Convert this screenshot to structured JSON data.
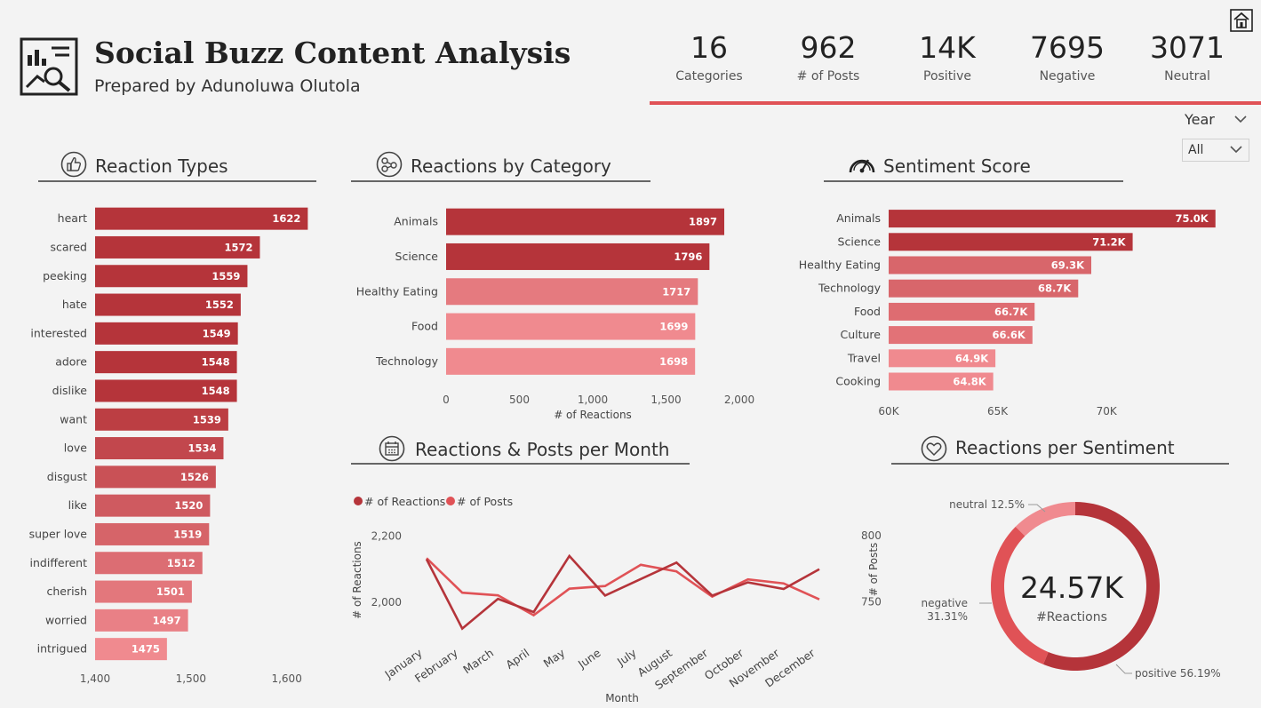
{
  "header": {
    "title": "Social Buzz Content Analysis",
    "subtitle": "Prepared by Adunoluwa Olutola"
  },
  "kpis": [
    {
      "value": "16",
      "label": "Categories"
    },
    {
      "value": "962",
      "label": "# of Posts"
    },
    {
      "value": "14K",
      "label": "Positive"
    },
    {
      "value": "7695",
      "label": "Negative"
    },
    {
      "value": "3071",
      "label": "Neutral"
    }
  ],
  "filter": {
    "label": "Year",
    "value": "All"
  },
  "sections": {
    "reaction_types": "Reaction Types",
    "reactions_by_category": "Reactions by Category",
    "sentiment_score": "Sentiment Score",
    "reactions_posts_month": "Reactions & Posts per Month",
    "reactions_per_sentiment": "Reactions per Sentiment"
  },
  "colors": {
    "accent": "#e05256",
    "dark_red": "#b5343a",
    "mid_red": "#d8666b",
    "light_red": "#f08a8f"
  },
  "chart_data": [
    {
      "id": "reaction_types",
      "type": "bar",
      "orientation": "horizontal",
      "categories": [
        "heart",
        "scared",
        "peeking",
        "hate",
        "interested",
        "adore",
        "dislike",
        "want",
        "love",
        "disgust",
        "like",
        "super love",
        "indifferent",
        "cherish",
        "worried",
        "intrigued"
      ],
      "values": [
        1622,
        1572,
        1559,
        1552,
        1549,
        1548,
        1548,
        1539,
        1534,
        1526,
        1520,
        1519,
        1512,
        1501,
        1497,
        1475
      ],
      "data_labels": [
        "1622",
        "1572",
        "1559",
        "1552",
        "1549",
        "1548",
        "1548",
        "1539",
        "1534",
        "1526",
        "1520",
        "1519",
        "1512",
        "1501",
        "1497",
        "1475"
      ],
      "xlim": [
        1400,
        1630
      ],
      "xticks": [
        1400,
        1500,
        1600
      ],
      "xtick_labels": [
        "1,400",
        "1,500",
        "1,600"
      ]
    },
    {
      "id": "reactions_by_category",
      "type": "bar",
      "orientation": "horizontal",
      "categories": [
        "Animals",
        "Science",
        "Healthy Eating",
        "Food",
        "Technology"
      ],
      "values": [
        1897,
        1796,
        1717,
        1699,
        1698
      ],
      "data_labels": [
        "1897",
        "1796",
        "1717",
        "1699",
        "1698"
      ],
      "xlim": [
        0,
        2000
      ],
      "xticks": [
        0,
        500,
        1000,
        1500,
        2000
      ],
      "xtick_labels": [
        "0",
        "500",
        "1,000",
        "1,500",
        "2,000"
      ],
      "xlabel": "# of Reactions"
    },
    {
      "id": "sentiment_score",
      "type": "bar",
      "orientation": "horizontal",
      "categories": [
        "Animals",
        "Science",
        "Healthy Eating",
        "Technology",
        "Food",
        "Culture",
        "Travel",
        "Cooking"
      ],
      "values": [
        75000,
        71200,
        69300,
        68700,
        66700,
        66600,
        64900,
        64800
      ],
      "data_labels": [
        "75.0K",
        "71.2K",
        "69.3K",
        "68.7K",
        "66.7K",
        "66.6K",
        "64.9K",
        "64.8K"
      ],
      "xlim": [
        60000,
        75500
      ],
      "xticks": [
        60000,
        65000,
        70000
      ],
      "xtick_labels": [
        "60K",
        "65K",
        "70K"
      ]
    },
    {
      "id": "reactions_posts_month",
      "type": "line",
      "categories": [
        "January",
        "February",
        "March",
        "April",
        "May",
        "June",
        "July",
        "August",
        "September",
        "October",
        "November",
        "December"
      ],
      "series": [
        {
          "name": "# of Reactions",
          "axis": "left",
          "values": [
            2130,
            1920,
            2010,
            1970,
            2140,
            2020,
            2070,
            2120,
            2020,
            2060,
            2040,
            2100
          ]
        },
        {
          "name": "# of Posts",
          "axis": "right",
          "values": [
            783,
            757,
            755,
            740,
            760,
            762,
            778,
            773,
            754,
            767,
            764,
            752
          ]
        }
      ],
      "xlabel": "Month",
      "ylabel": "# of Reactions",
      "y2label": "# of Posts",
      "ylim": [
        1900,
        2250
      ],
      "yticks": [
        2000,
        2200
      ],
      "ytick_labels": [
        "2,000",
        "2,200"
      ],
      "y2lim": [
        725,
        812
      ],
      "y2ticks": [
        750,
        800
      ],
      "y2tick_labels": [
        "750",
        "800"
      ],
      "legend": "top-left"
    },
    {
      "id": "reactions_per_sentiment",
      "type": "pie",
      "donut": true,
      "center_value": "24.57K",
      "center_label": "#Reactions",
      "slices": [
        {
          "label": "positive",
          "value": 56.19,
          "display": "positive 56.19%"
        },
        {
          "label": "negative",
          "value": 31.31,
          "display_a": "negative",
          "display_b": "31.31%"
        },
        {
          "label": "neutral",
          "value": 12.5,
          "display": "neutral 12.5%"
        }
      ]
    }
  ]
}
